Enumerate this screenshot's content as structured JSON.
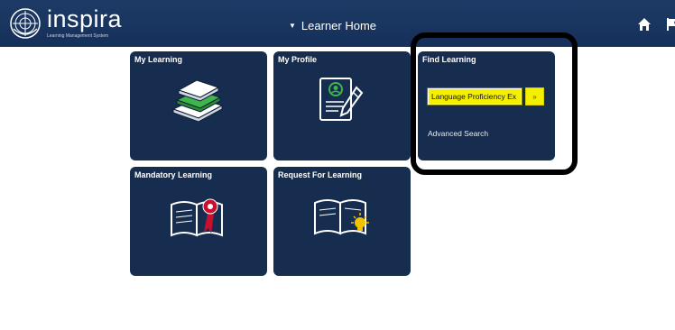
{
  "header": {
    "brand_name": "inspira",
    "brand_subtitle": "Learning Management System",
    "page_title": "Learner Home",
    "title_caret": "▼",
    "icons": [
      "un-emblem-icon",
      "home-icon",
      "flag-icon"
    ]
  },
  "tiles": {
    "my_learning": {
      "title": "My Learning",
      "icon": "stacked-books-icon"
    },
    "my_profile": {
      "title": "My Profile",
      "icon": "profile-document-pen-icon"
    },
    "find_learning": {
      "title": "Find Learning",
      "search_value": "Language Proficiency Ex",
      "search_button": "»",
      "advanced_search": "Advanced Search"
    },
    "mandatory_learning": {
      "title": "Mandatory Learning",
      "icon": "open-book-ribbon-icon"
    },
    "request_for_learning": {
      "title": "Request For Learning",
      "icon": "open-book-lightbulb-icon"
    }
  },
  "colors": {
    "header_bg": "#1d3b66",
    "tile_bg": "#172d4f",
    "search_highlight": "#f5f000",
    "annotation_border": "#000000",
    "green_accent": "#3db54a",
    "ribbon_red": "#c8102e"
  }
}
